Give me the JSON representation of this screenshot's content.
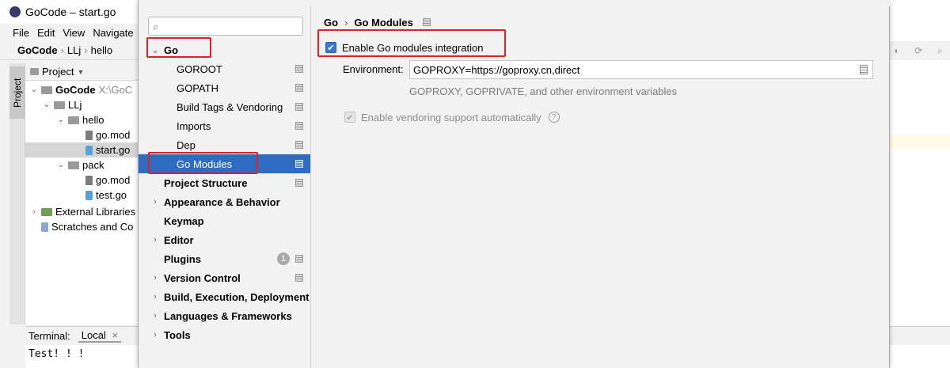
{
  "ide": {
    "title": "GoCode – start.go",
    "menu": [
      "File",
      "Edit",
      "View",
      "Navigate"
    ],
    "nav": {
      "project": "GoCode",
      "folder1": "LLj",
      "folder2": "hello"
    },
    "side_tab": "Project",
    "project_header": "Project",
    "tree": [
      {
        "label": "GoCode",
        "suffix": " X:\\GoC"
      },
      {
        "label": "LLj"
      },
      {
        "label": "hello"
      },
      {
        "label": "go.mod"
      },
      {
        "label": "start.go"
      },
      {
        "label": "pack"
      },
      {
        "label": "go.mod"
      },
      {
        "label": "test.go"
      },
      {
        "label": "External Libraries"
      },
      {
        "label": "Scratches and Co"
      }
    ],
    "terminal": {
      "label": "Terminal:",
      "tab": "Local",
      "close": "×",
      "output": "Test! ! !"
    }
  },
  "settings": {
    "search": {
      "value": "",
      "placeholder": ""
    },
    "tree": [
      {
        "label": "Go",
        "expanded": true
      },
      {
        "label": "GOROOT"
      },
      {
        "label": "GOPATH"
      },
      {
        "label": "Build Tags & Vendoring"
      },
      {
        "label": "Imports"
      },
      {
        "label": "Dep"
      },
      {
        "label": "Go Modules",
        "selected": true
      },
      {
        "label": "Project Structure"
      },
      {
        "label": "Appearance & Behavior"
      },
      {
        "label": "Keymap"
      },
      {
        "label": "Editor"
      },
      {
        "label": "Plugins",
        "badge": "1"
      },
      {
        "label": "Version Control"
      },
      {
        "label": "Build, Execution, Deployment"
      },
      {
        "label": "Languages & Frameworks"
      },
      {
        "label": "Tools"
      }
    ],
    "breadcrumb": {
      "parent": "Go",
      "separator": "›",
      "current": "Go Modules"
    },
    "enable_modules": {
      "label": "Enable Go modules integration",
      "checked": true
    },
    "environment": {
      "label": "Environment:",
      "value": "GOPROXY=https://goproxy.cn,direct",
      "hint": "GOPROXY, GOPRIVATE, and other environment variables"
    },
    "vendoring": {
      "label": "Enable vendoring support automatically",
      "checked": true,
      "disabled": true,
      "help": "?"
    }
  },
  "colors": {
    "selection": "#2f6bc0",
    "annotation": "#e3202a",
    "checkbox": "#3a79d0"
  },
  "icons": [
    "search-icon",
    "chevron-down-icon",
    "chevron-right-icon",
    "project-level-icon",
    "document-icon",
    "help-icon",
    "checkmark-icon",
    "folder-icon",
    "go-file-icon"
  ]
}
